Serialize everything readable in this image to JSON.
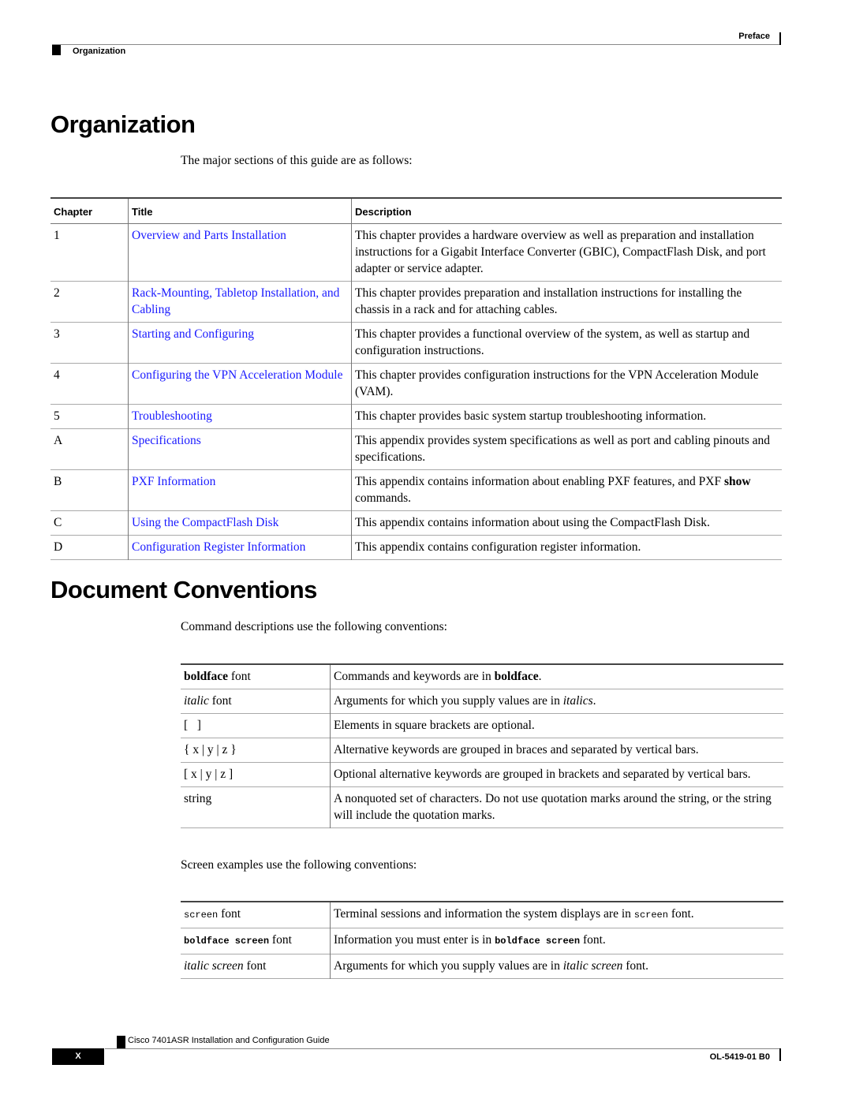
{
  "header": {
    "section": "Preface",
    "topic": "Organization"
  },
  "organization": {
    "heading": "Organization",
    "intro": "The major sections of this guide are as follows:",
    "columns": [
      "Chapter",
      "Title",
      "Description"
    ],
    "rows": [
      {
        "chapter": "1",
        "title": "Overview and Parts Installation",
        "description": "This chapter provides a hardware overview as well as preparation and installation instructions for a Gigabit Interface Converter (GBIC), CompactFlash Disk, and port adapter or service adapter."
      },
      {
        "chapter": "2",
        "title": "Rack-Mounting, Tabletop Installation, and Cabling",
        "description": "This chapter provides preparation and installation instructions for installing the chassis in a rack and for attaching cables."
      },
      {
        "chapter": "3",
        "title": "Starting and Configuring",
        "description": "This chapter provides a functional overview of the system, as well as startup and configuration instructions."
      },
      {
        "chapter": "4",
        "title": "Configuring the VPN Acceleration Module",
        "description": "This chapter provides configuration instructions for the VPN Acceleration Module (VAM)."
      },
      {
        "chapter": "5",
        "title": "Troubleshooting",
        "description": "This chapter provides basic system startup troubleshooting information."
      },
      {
        "chapter": "A",
        "title": "Specifications",
        "description": "This appendix provides system specifications as well as port and cabling pinouts and specifications."
      },
      {
        "chapter": "B",
        "title": "PXF Information",
        "description_pre": "This appendix contains information about enabling PXF features, and PXF ",
        "description_bold": "show",
        "description_post": " commands."
      },
      {
        "chapter": "C",
        "title": "Using the CompactFlash Disk",
        "description": "This appendix contains information about using the CompactFlash Disk."
      },
      {
        "chapter": "D",
        "title": "Configuration Register Information",
        "description": "This appendix contains configuration register information."
      }
    ]
  },
  "conventions": {
    "heading": "Document Conventions",
    "command_intro": "Command descriptions use the following conventions:",
    "command_rows": [
      {
        "k_styled": "boldface",
        "k_plain": " font",
        "d_pre": "Commands and keywords are in ",
        "d_styled": "boldface",
        "d_post": "."
      },
      {
        "k_styled": "italic",
        "k_plain": " font",
        "d_pre": "Arguments for which you supply values are in ",
        "d_styled": "italics",
        "d_post": "."
      },
      {
        "key": "[   ]",
        "desc": "Elements in square brackets are optional."
      },
      {
        "key": "{ x | y | z }",
        "desc": "Alternative keywords are grouped in braces and separated by vertical bars."
      },
      {
        "key": "[ x | y | z ]",
        "desc": "Optional alternative keywords are grouped in brackets and separated by vertical bars."
      },
      {
        "key": "string",
        "desc": "A nonquoted set of characters. Do not use quotation marks around the string, or the string will include the quotation marks."
      }
    ],
    "screen_intro": "Screen examples use the following conventions:",
    "screen_rows": [
      {
        "k_styled": "screen",
        "k_plain": " font",
        "d_pre": "Terminal sessions and information the system displays are in ",
        "d_styled": "screen",
        "d_post": " font."
      },
      {
        "k_styled": "boldface screen",
        "k_plain": " font",
        "d_pre": "Information you must enter is in ",
        "d_styled": "boldface screen",
        "d_post": " font."
      },
      {
        "k_styled": "italic screen",
        "k_plain": " font",
        "d_pre": "Arguments for which you supply values are in ",
        "d_styled": "italic screen",
        "d_post": " font."
      }
    ]
  },
  "footer": {
    "guide_title": "Cisco 7401ASR Installation and Configuration Guide",
    "page": "X",
    "doc_number": "OL-5419-01 B0"
  }
}
